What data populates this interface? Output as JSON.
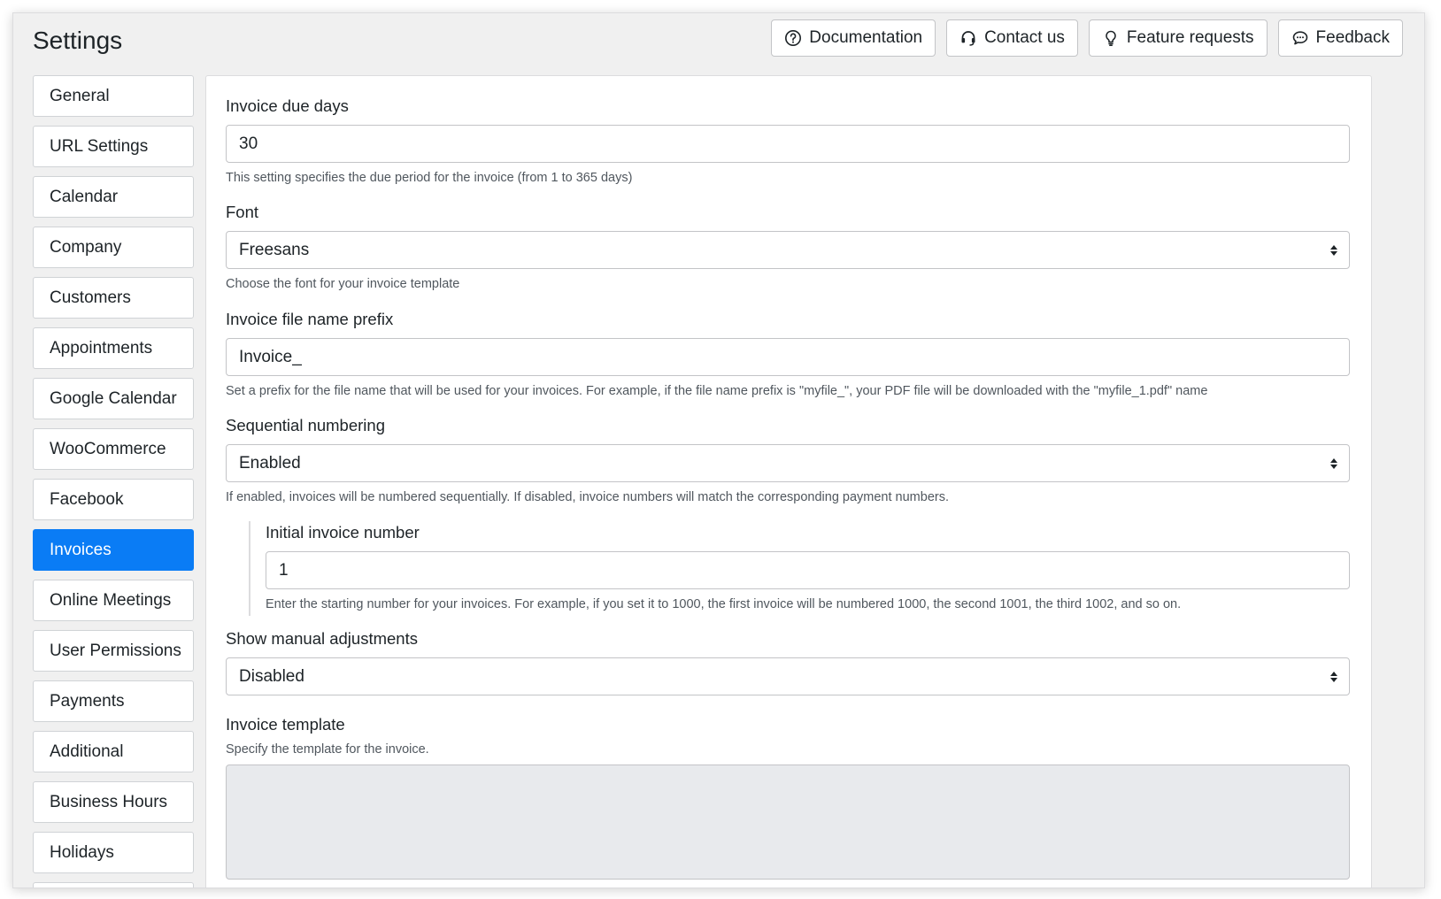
{
  "header": {
    "title": "Settings",
    "buttons": [
      {
        "label": "Documentation",
        "icon": "question-circle-icon"
      },
      {
        "label": "Contact us",
        "icon": "headset-icon"
      },
      {
        "label": "Feature requests",
        "icon": "lightbulb-icon"
      },
      {
        "label": "Feedback",
        "icon": "chat-bubble-icon"
      }
    ]
  },
  "sidebar": {
    "items": [
      {
        "label": "General"
      },
      {
        "label": "URL Settings"
      },
      {
        "label": "Calendar"
      },
      {
        "label": "Company"
      },
      {
        "label": "Customers"
      },
      {
        "label": "Appointments"
      },
      {
        "label": "Google Calendar"
      },
      {
        "label": "WooCommerce"
      },
      {
        "label": "Facebook"
      },
      {
        "label": "Invoices"
      },
      {
        "label": "Online Meetings"
      },
      {
        "label": "User Permissions"
      },
      {
        "label": "Payments"
      },
      {
        "label": "Additional"
      },
      {
        "label": "Business Hours"
      },
      {
        "label": "Holidays"
      }
    ],
    "active": "Invoices"
  },
  "form": {
    "due_days": {
      "label": "Invoice due days",
      "value": "30",
      "help": "This setting specifies the due period for the invoice (from 1 to 365 days)"
    },
    "font": {
      "label": "Font",
      "value": "Freesans",
      "help": "Choose the font for your invoice template"
    },
    "prefix": {
      "label": "Invoice file name prefix",
      "value": "Invoice_",
      "help": "Set a prefix for the file name that will be used for your invoices. For example, if the file name prefix is \"myfile_\", your PDF file will be downloaded with the \"myfile_1.pdf\" name"
    },
    "sequential": {
      "label": "Sequential numbering",
      "value": "Enabled",
      "help": "If enabled, invoices will be numbered sequentially. If disabled, invoice numbers will match the corresponding payment numbers."
    },
    "initial_number": {
      "label": "Initial invoice number",
      "value": "1",
      "help": "Enter the starting number for your invoices. For example, if you set it to 1000, the first invoice will be numbered 1000, the second 1001, the third 1002, and so on."
    },
    "manual_adjustments": {
      "label": "Show manual adjustments",
      "value": "Disabled"
    },
    "template": {
      "label": "Invoice template",
      "help": "Specify the template for the invoice."
    }
  },
  "colors": {
    "accent": "#0a7cf5",
    "background": "#f0f0f0",
    "textarea_bg": "#e8eaed"
  }
}
